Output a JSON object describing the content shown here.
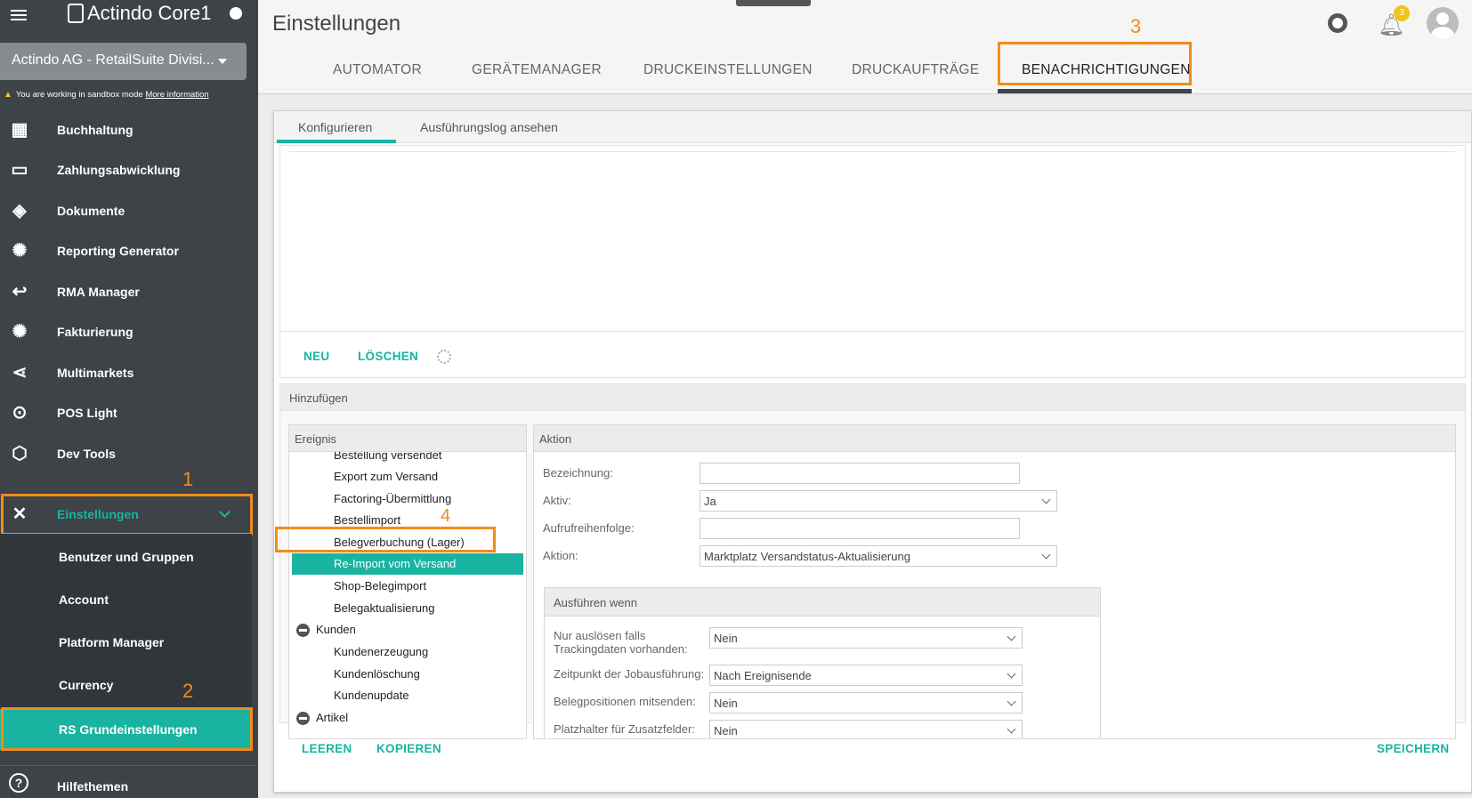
{
  "sidebar": {
    "logo": "Actindo Core1",
    "account": "Actindo AG - RetailSuite Divisi...",
    "sandbox_notice": "You are working in sandbox mode",
    "sandbox_link": "More information",
    "items": [
      {
        "label": "Buchhaltung",
        "icon": "calculator-icon"
      },
      {
        "label": "Zahlungsabwicklung",
        "icon": "money-icon"
      },
      {
        "label": "Dokumente",
        "icon": "layers-icon"
      },
      {
        "label": "Reporting Generator",
        "icon": "atom-icon"
      },
      {
        "label": "RMA Manager",
        "icon": "return-arrow-icon"
      },
      {
        "label": "Fakturierung",
        "icon": "atom-icon"
      },
      {
        "label": "Multimarkets",
        "icon": "share-icon"
      },
      {
        "label": "POS Light",
        "icon": "map-pin-icon"
      },
      {
        "label": "Dev Tools",
        "icon": "box-icon"
      },
      {
        "label": "Einstellungen",
        "icon": "tools-icon"
      }
    ],
    "submenu": [
      "Benutzer und Gruppen",
      "Account",
      "Platform Manager",
      "Currency",
      "RS Grundeinstellungen"
    ],
    "help": "Hilfethemen"
  },
  "annotations": [
    "1",
    "2",
    "3",
    "4"
  ],
  "header": {
    "title": "Einstellungen",
    "tabs": [
      "AUTOMATOR",
      "GERÄTEMANAGER",
      "DRUCKEINSTELLUNGEN",
      "DRUCKAUFTRÄGE",
      "BENACHRICHTIGUNGEN"
    ],
    "notification_count": "3"
  },
  "main": {
    "subtabs": [
      "Konfigurieren",
      "Ausführungslog ansehen"
    ],
    "toolbar": {
      "new": "NEU",
      "delete": "LÖSCHEN"
    },
    "add_title": "Hinzufügen",
    "event_panel": {
      "title": "Ereignis",
      "items": [
        "Bestellung versendet",
        "Export zum Versand",
        "Factoring-Übermittlung",
        "Bestellimport",
        "Belegverbuchung (Lager)",
        "Re-Import vom Versand",
        "Shop-Belegimport",
        "Belegaktualisierung",
        "Kunden",
        "Kundenerzeugung",
        "Kundenlöschung",
        "Kundenupdate",
        "Artikel"
      ]
    },
    "action_panel": {
      "title": "Aktion",
      "fields": {
        "bezeichnung_label": "Bezeichnung:",
        "bezeichnung_value": "",
        "aktiv_label": "Aktiv:",
        "aktiv_value": "Ja",
        "reihenfolge_label": "Aufrufreihenfolge:",
        "reihenfolge_value": "",
        "aktion_label": "Aktion:",
        "aktion_value": "Marktplatz Versandstatus-Aktualisierung"
      },
      "execute_when": {
        "title": "Ausführen wenn",
        "tracking_label_1": "Nur auslösen falls",
        "tracking_label_2": "Trackingdaten vorhanden:",
        "tracking_value": "Nein",
        "zeitpunkt_label": "Zeitpunkt der Jobausführung:",
        "zeitpunkt_value": "Nach Ereignisende",
        "positionen_label": "Belegpositionen mitsenden:",
        "positionen_value": "Nein",
        "platzhalter_label": "Platzhalter für Zusatzfelder:",
        "platzhalter_value": "Nein"
      }
    },
    "footer": {
      "clear": "LEEREN",
      "copy": "KOPIEREN",
      "save": "SPEICHERN"
    }
  },
  "colors": {
    "accent": "#19b3a1",
    "sidebar": "#3d4346",
    "annotation": "#f28c1b"
  }
}
